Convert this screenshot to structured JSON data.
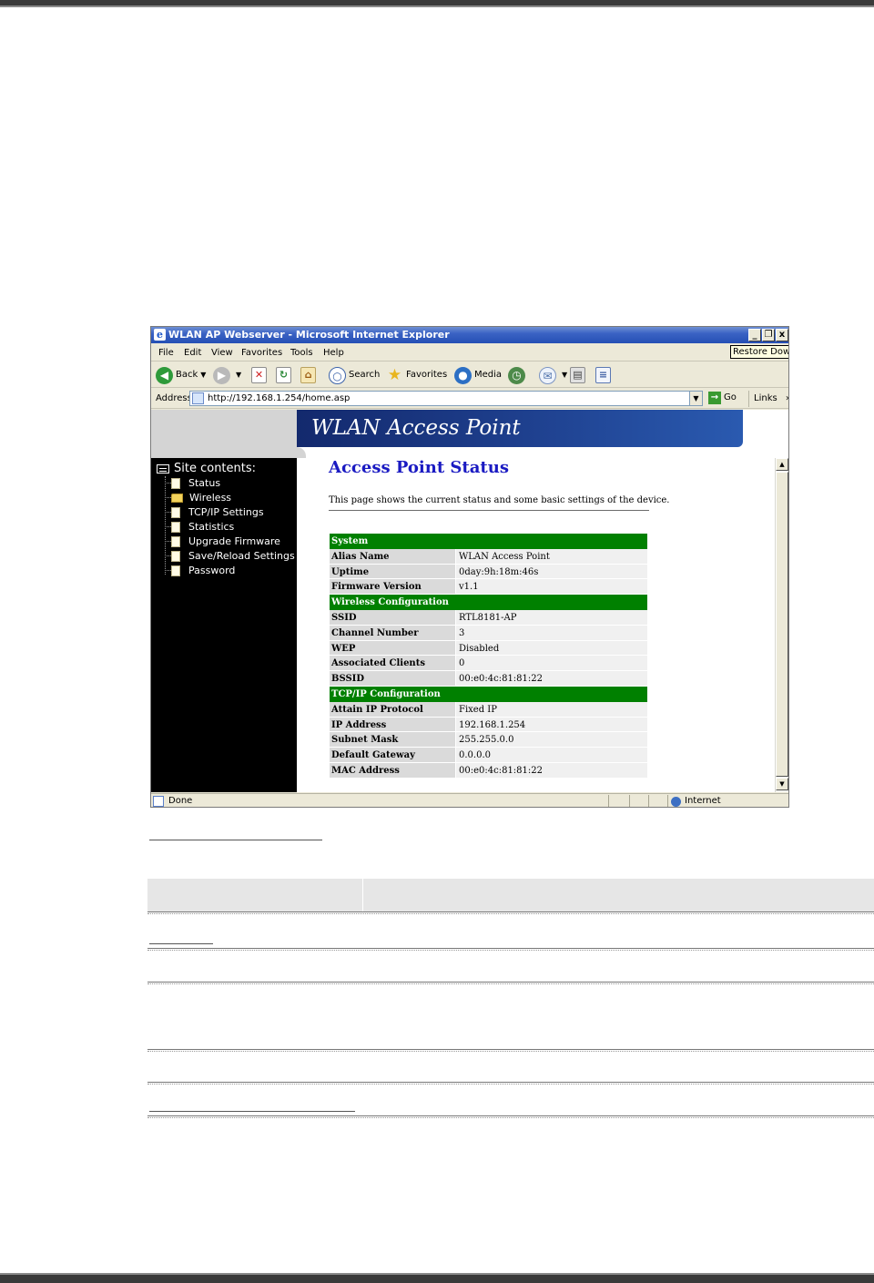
{
  "window": {
    "title": "WLAN AP Webserver - Microsoft Internet Explorer",
    "tooltip": "Restore Down",
    "minimize_glyph": "_",
    "maximize_glyph": "❐",
    "close_glyph": "x"
  },
  "menu": [
    "File",
    "Edit",
    "View",
    "Favorites",
    "Tools",
    "Help"
  ],
  "toolbar": {
    "back": "Back",
    "search": "Search",
    "favorites": "Favorites",
    "media": "Media"
  },
  "address": {
    "label": "Address",
    "url": "http://192.168.1.254/home.asp",
    "go": "Go",
    "links": "Links",
    "links_chevron": "»"
  },
  "banner": {
    "title": "WLAN Access Point"
  },
  "sidebar": {
    "heading": "Site contents:",
    "items": [
      {
        "label": "Status",
        "icon": "document-icon"
      },
      {
        "label": "Wireless",
        "icon": "folder-icon"
      },
      {
        "label": "TCP/IP Settings",
        "icon": "document-icon"
      },
      {
        "label": "Statistics",
        "icon": "document-icon"
      },
      {
        "label": "Upgrade Firmware",
        "icon": "document-icon"
      },
      {
        "label": "Save/Reload Settings",
        "icon": "document-icon"
      },
      {
        "label": "Password",
        "icon": "document-icon"
      }
    ]
  },
  "content": {
    "title": "Access Point Status",
    "description": "This page shows the current status and some basic settings of the device."
  },
  "status": {
    "system": {
      "heading": "System",
      "rows": [
        {
          "key": "Alias Name",
          "value": "WLAN Access Point"
        },
        {
          "key": "Uptime",
          "value": "0day:9h:18m:46s"
        },
        {
          "key": "Firmware Version",
          "value": "v1.1"
        }
      ]
    },
    "wireless": {
      "heading": "Wireless Configuration",
      "rows": [
        {
          "key": "SSID",
          "value": "RTL8181-AP"
        },
        {
          "key": "Channel Number",
          "value": "3"
        },
        {
          "key": "WEP",
          "value": "Disabled"
        },
        {
          "key": "Associated Clients",
          "value": "0"
        },
        {
          "key": "BSSID",
          "value": "00:e0:4c:81:81:22"
        }
      ]
    },
    "tcpip": {
      "heading": "TCP/IP Configuration",
      "rows": [
        {
          "key": "Attain IP Protocol",
          "value": "Fixed IP"
        },
        {
          "key": "IP Address",
          "value": "192.168.1.254"
        },
        {
          "key": "Subnet Mask",
          "value": "255.255.0.0"
        },
        {
          "key": "Default Gateway",
          "value": "0.0.0.0"
        },
        {
          "key": "MAC Address",
          "value": "00:e0:4c:81:81:22"
        }
      ]
    }
  },
  "statusbar": {
    "text": "Done",
    "zone": "Internet"
  },
  "colors": {
    "section_green": "#008000",
    "title_blue": "#1a1ac2",
    "sidebar_black": "#000000",
    "banner_navy": "#13296d"
  }
}
